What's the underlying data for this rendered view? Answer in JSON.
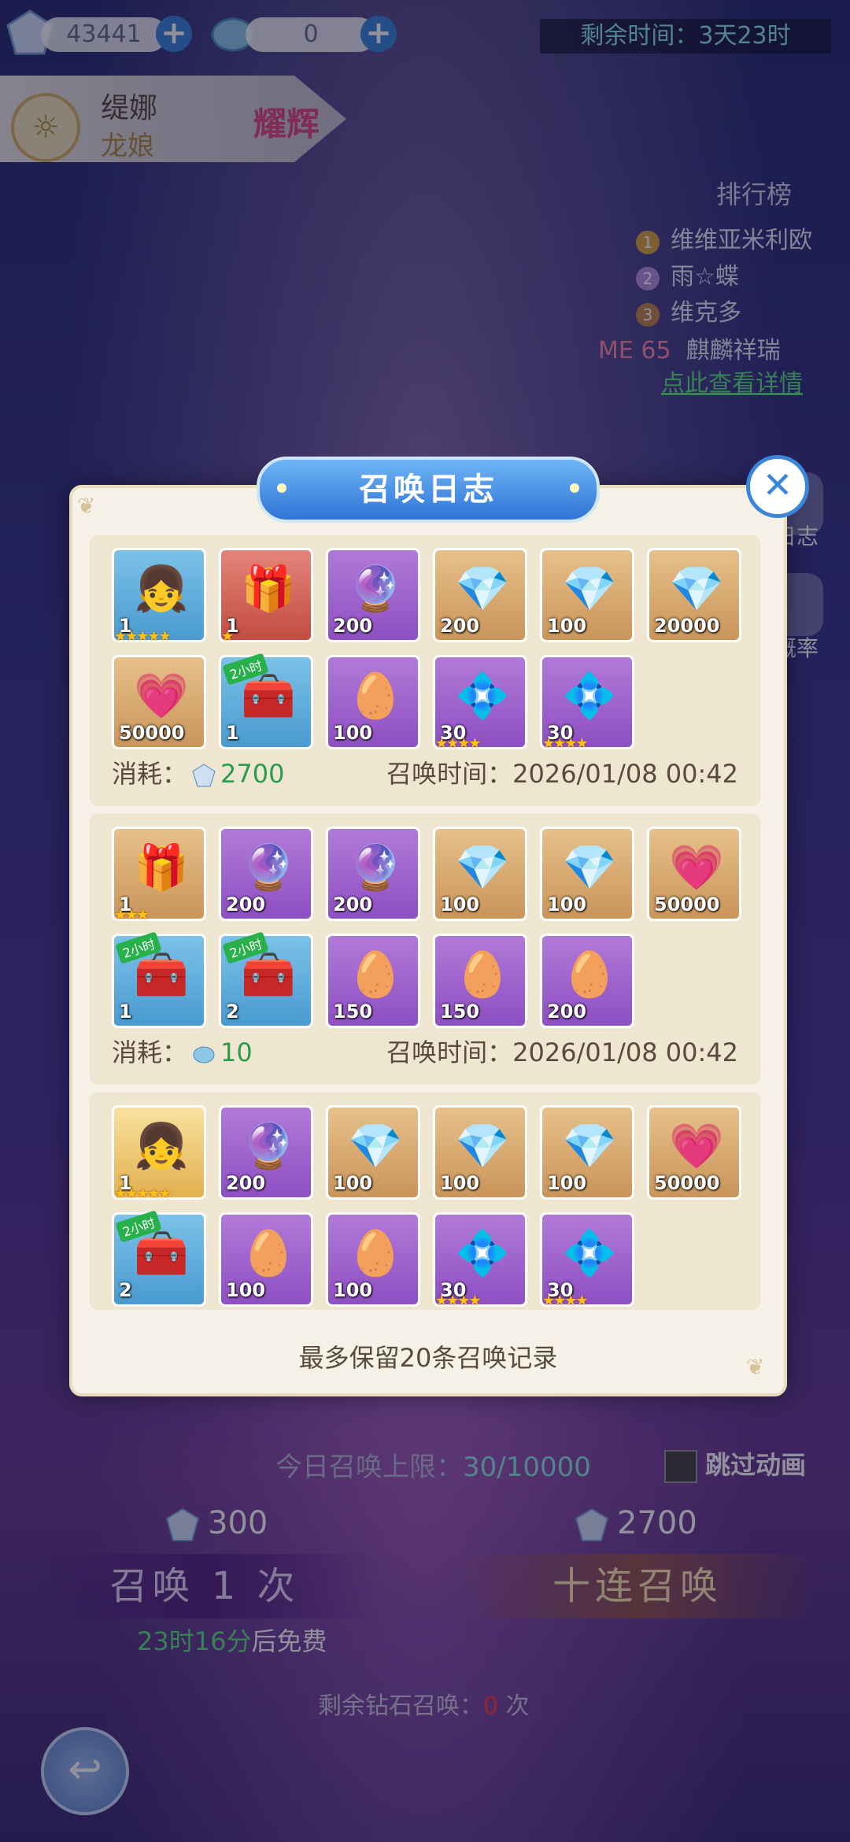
{
  "top": {
    "diamond_count": "43441",
    "crystal_count": "0",
    "remaining_time_label": "剩余时间：3天23时"
  },
  "hero": {
    "name": "缇娜",
    "race": "龙娘",
    "badge": "耀辉"
  },
  "ranking": {
    "title": "排行榜",
    "entries": [
      {
        "rank": "1",
        "name": "维维亚米利欧",
        "color": "#d8a63a"
      },
      {
        "rank": "2",
        "name": "雨☆蝶",
        "color": "#b88fd8"
      },
      {
        "rank": "3",
        "name": "维克多",
        "color": "#c4864a"
      }
    ],
    "me_label": "ME 65",
    "me_name": "麒麟祥瑞",
    "detail_link": "点此查看详情"
  },
  "side": {
    "log_label": "日志",
    "prob_label": "概率"
  },
  "modal": {
    "title": "召唤日志",
    "close": "✕",
    "note": "最多保留20条召唤记录",
    "consume_label": "消耗：",
    "time_label": "召唤时间：",
    "records": [
      {
        "cost": "2700",
        "cost_currency": "diamond",
        "time": "2026/01/08 00:42",
        "items": [
          {
            "type": "hero",
            "icon": "👧",
            "count": "1",
            "stars": "★★★★★",
            "bg": "blue"
          },
          {
            "type": "box",
            "icon": "🎁",
            "count": "1",
            "stars": "★",
            "bg": "red"
          },
          {
            "type": "orb",
            "icon": "🔮",
            "count": "200",
            "stars": "",
            "bg": "purple"
          },
          {
            "type": "gem",
            "icon": "💎",
            "count": "200",
            "stars": "",
            "bg": "gold"
          },
          {
            "type": "gem",
            "icon": "💎",
            "count": "100",
            "stars": "",
            "bg": "gold"
          },
          {
            "type": "gem",
            "icon": "💎",
            "count": "20000",
            "stars": "",
            "bg": "gold"
          },
          {
            "type": "exp",
            "icon": "💗",
            "count": "50000",
            "stars": "",
            "bg": "gold"
          },
          {
            "type": "chest",
            "icon": "🧰",
            "count": "1",
            "stars": "",
            "bg": "blue",
            "tag": "2小时"
          },
          {
            "type": "egg",
            "icon": "🥚",
            "count": "100",
            "stars": "",
            "bg": "purple"
          },
          {
            "type": "shard",
            "icon": "💠",
            "count": "30",
            "stars": "★★★★",
            "bg": "purple"
          },
          {
            "type": "shard",
            "icon": "💠",
            "count": "30",
            "stars": "★★★★",
            "bg": "purple"
          }
        ]
      },
      {
        "cost": "10",
        "cost_currency": "crystal",
        "time": "2026/01/08 00:42",
        "items": [
          {
            "type": "box",
            "icon": "🎁",
            "count": "1",
            "stars": "★★★",
            "bg": "gold"
          },
          {
            "type": "orb",
            "icon": "🔮",
            "count": "200",
            "stars": "",
            "bg": "purple"
          },
          {
            "type": "orb",
            "icon": "🔮",
            "count": "200",
            "stars": "",
            "bg": "purple"
          },
          {
            "type": "gem",
            "icon": "💎",
            "count": "100",
            "stars": "",
            "bg": "gold"
          },
          {
            "type": "gem",
            "icon": "💎",
            "count": "100",
            "stars": "",
            "bg": "gold"
          },
          {
            "type": "exp",
            "icon": "💗",
            "count": "50000",
            "stars": "",
            "bg": "gold"
          },
          {
            "type": "chest",
            "icon": "🧰",
            "count": "1",
            "stars": "",
            "bg": "blue",
            "tag": "2小时"
          },
          {
            "type": "chest",
            "icon": "🧰",
            "count": "2",
            "stars": "",
            "bg": "blue",
            "tag": "2小时"
          },
          {
            "type": "egg",
            "icon": "🥚",
            "count": "150",
            "stars": "",
            "bg": "purple"
          },
          {
            "type": "egg",
            "icon": "🥚",
            "count": "150",
            "stars": "",
            "bg": "purple"
          },
          {
            "type": "egg",
            "icon": "🥚",
            "count": "200",
            "stars": "",
            "bg": "purple"
          }
        ]
      },
      {
        "cost": "",
        "cost_currency": "",
        "time": "",
        "items": [
          {
            "type": "hero",
            "icon": "👧",
            "count": "1",
            "stars": "★★★★★",
            "bg": "hero"
          },
          {
            "type": "orb",
            "icon": "🔮",
            "count": "200",
            "stars": "",
            "bg": "purple"
          },
          {
            "type": "gem",
            "icon": "💎",
            "count": "100",
            "stars": "",
            "bg": "gold"
          },
          {
            "type": "gem",
            "icon": "💎",
            "count": "100",
            "stars": "",
            "bg": "gold"
          },
          {
            "type": "gem",
            "icon": "💎",
            "count": "100",
            "stars": "",
            "bg": "gold"
          },
          {
            "type": "exp",
            "icon": "💗",
            "count": "50000",
            "stars": "",
            "bg": "gold"
          },
          {
            "type": "chest",
            "icon": "🧰",
            "count": "2",
            "stars": "",
            "bg": "blue",
            "tag": "2小时"
          },
          {
            "type": "egg",
            "icon": "🥚",
            "count": "100",
            "stars": "",
            "bg": "purple"
          },
          {
            "type": "egg",
            "icon": "🥚",
            "count": "100",
            "stars": "",
            "bg": "purple"
          },
          {
            "type": "shard",
            "icon": "💠",
            "count": "30",
            "stars": "★★★★",
            "bg": "purple"
          },
          {
            "type": "shard",
            "icon": "💠",
            "count": "30",
            "stars": "★★★★",
            "bg": "purple"
          }
        ]
      }
    ]
  },
  "bottom": {
    "daily_limit_label": "今日召唤上限：",
    "daily_limit_value": "30/10000",
    "skip_anim": "跳过动画",
    "single_cost": "300",
    "ten_cost": "2700",
    "single_btn": "召唤 1 次",
    "ten_btn": "十连召唤",
    "free_time": "23时16分",
    "free_suffix": "后免费",
    "remain_label": "剩余钻石召唤：",
    "remain_value": "0",
    "remain_unit": "次"
  }
}
